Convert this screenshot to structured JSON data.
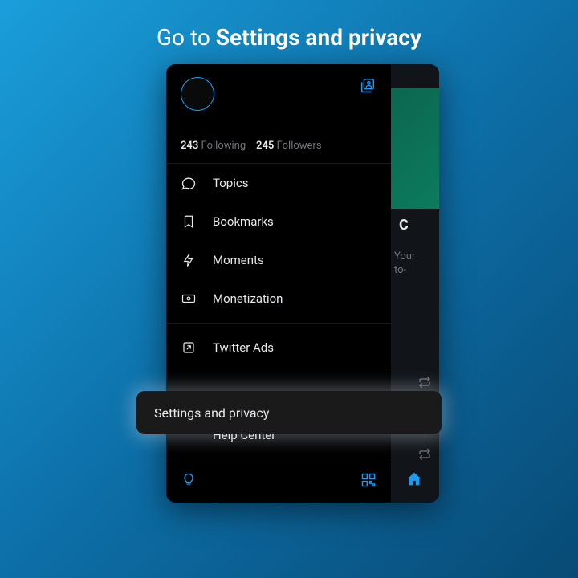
{
  "headline": {
    "prefix": "Go to ",
    "bold": "Settings and privacy"
  },
  "stats": {
    "following_count": "243",
    "following_label": "Following",
    "followers_count": "245",
    "followers_label": "Followers"
  },
  "menu": {
    "topics": "Topics",
    "bookmarks": "Bookmarks",
    "moments": "Moments",
    "monetization": "Monetization",
    "twitter_ads": "Twitter Ads",
    "settings_privacy": "Settings and privacy",
    "help_center": "Help Center"
  },
  "peek": {
    "title_fragment": "C",
    "body_line1": "Your",
    "body_line2": "to-"
  },
  "callout": {
    "label": "Settings and privacy"
  }
}
